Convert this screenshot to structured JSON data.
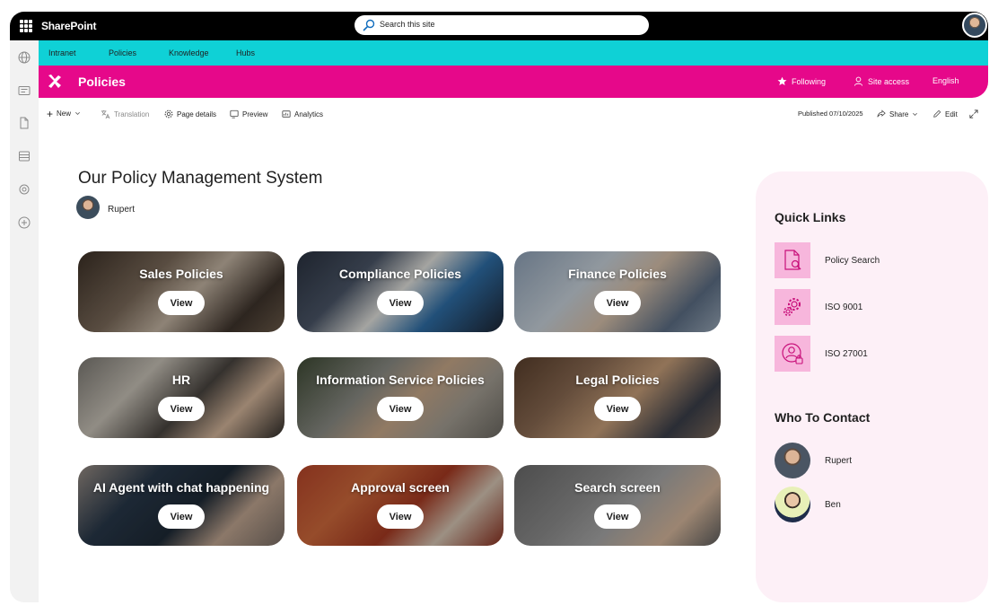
{
  "suite": {
    "brand": "SharePoint",
    "search_placeholder": "Search this site"
  },
  "hub_nav": [
    "Intranet",
    "Policies",
    "Knowledge",
    "Hubs"
  ],
  "site": {
    "title": "Policies",
    "following": "Following",
    "site_access": "Site access",
    "language": "English"
  },
  "command_bar": {
    "new": "New",
    "translation": "Translation",
    "page_details": "Page details",
    "preview": "Preview",
    "analytics": "Analytics",
    "published": "Published 07/10/2025",
    "share": "Share",
    "edit": "Edit"
  },
  "page": {
    "title": "Our Policy Management System",
    "author": "Rupert"
  },
  "tiles": [
    {
      "title": "Sales Policies",
      "button": "View"
    },
    {
      "title": "Compliance Policies",
      "button": "View"
    },
    {
      "title": "Finance Policies",
      "button": "View"
    },
    {
      "title": "HR",
      "button": "View"
    },
    {
      "title": "Information Service Policies",
      "button": "View"
    },
    {
      "title": "Legal Policies",
      "button": "View"
    },
    {
      "title": "AI Agent with chat happening",
      "button": "View"
    },
    {
      "title": "Approval screen",
      "button": "View"
    },
    {
      "title": "Search screen",
      "button": "View"
    }
  ],
  "quick_links": {
    "heading": "Quick Links",
    "items": [
      {
        "label": "Policy Search",
        "icon": "document-search-icon"
      },
      {
        "label": "ISO 9001",
        "icon": "gears-icon"
      },
      {
        "label": "ISO 27001",
        "icon": "user-lock-icon"
      }
    ]
  },
  "contacts": {
    "heading": "Who To Contact",
    "people": [
      "Rupert",
      "Ben"
    ]
  },
  "colors": {
    "hub_nav": "#0fd1d6",
    "site_header": "#e6088a",
    "panel_bg": "#fdf0f7",
    "icon_tile": "#f7b6dc"
  }
}
